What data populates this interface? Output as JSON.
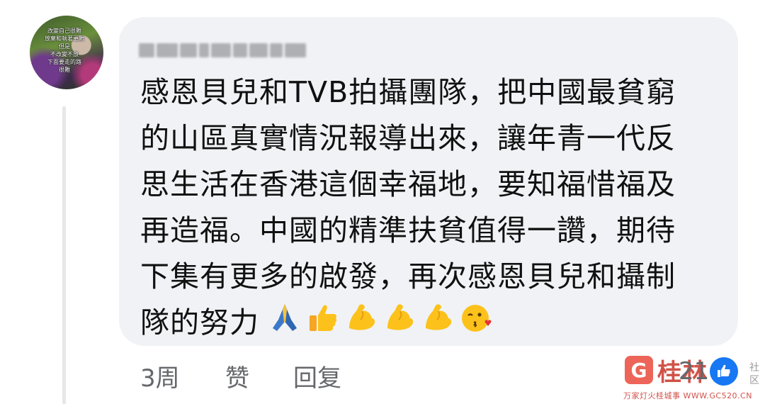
{
  "avatar": {
    "text_lines": [
      "改變自己很難",
      "放棄和執著更難",
      "但是",
      "不改變不放",
      "下面要走的路",
      "很難"
    ]
  },
  "comment": {
    "lines": [
      "感恩貝兒和TVB拍攝團隊，把中國最貧窮",
      "的山區真實情況報導出來，讓年青一代反",
      "思生活在香港這個幸福地，要知福惜福及",
      "再造福。中國的精準扶貧值得一讚，期待",
      "下集有更多的啟發，再次感恩貝兒和攝制",
      "隊的努力"
    ],
    "emojis": [
      "folded-hands",
      "thumbs-up",
      "flexed-biceps",
      "flexed-biceps",
      "flexed-biceps",
      "face-blowing-kiss"
    ]
  },
  "footer": {
    "time": "3周",
    "like": "赞",
    "reply": "回复",
    "like_count": "21"
  },
  "watermark": {
    "brand": "桂林",
    "logo_letter": "G",
    "sub": "万家灯火桂城事 WWW.GC520.CN",
    "side": "社区"
  },
  "colors": {
    "bubble": "#f0f2f5",
    "text": "#111111",
    "meta": "#65676b",
    "like_blue": "#1877f2"
  }
}
